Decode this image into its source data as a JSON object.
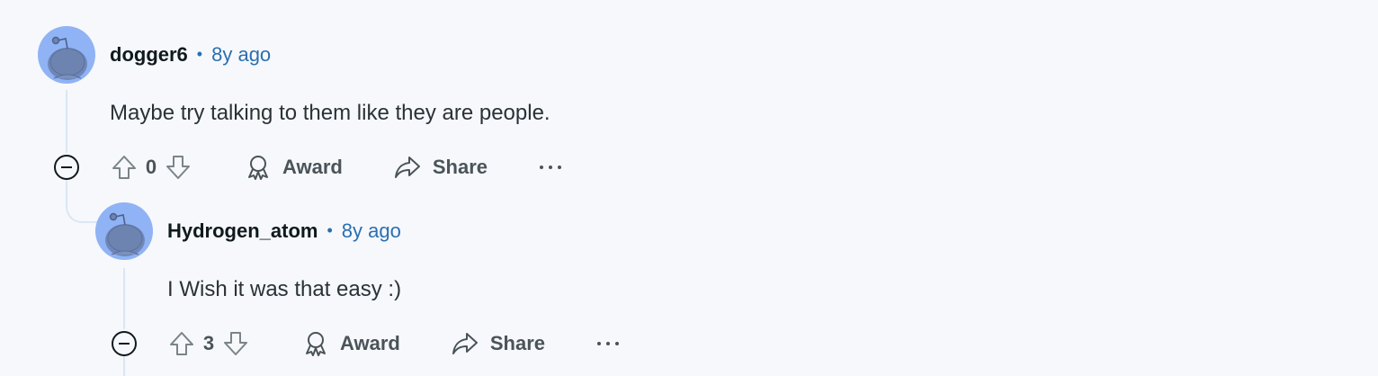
{
  "comments": [
    {
      "author": "dogger6",
      "separator": "•",
      "time": "8y ago",
      "body": "Maybe try talking to them like they are people.",
      "score": "0",
      "award_label": "Award",
      "share_label": "Share"
    },
    {
      "author": "Hydrogen_atom",
      "separator": "•",
      "time": "8y ago",
      "body": "I Wish it was that easy :)",
      "score": "3",
      "award_label": "Award",
      "share_label": "Share"
    }
  ],
  "colors": {
    "background": "#f7f8fc",
    "avatar": "#8fb3f5",
    "timestamp": "#2a6fb0",
    "thread_line": "#dbe6f5"
  },
  "icons": [
    "reddit-snoo-avatar-icon",
    "collapse-minus-icon",
    "upvote-arrow-icon",
    "downvote-arrow-icon",
    "award-icon",
    "share-arrow-icon",
    "more-options-icon"
  ]
}
